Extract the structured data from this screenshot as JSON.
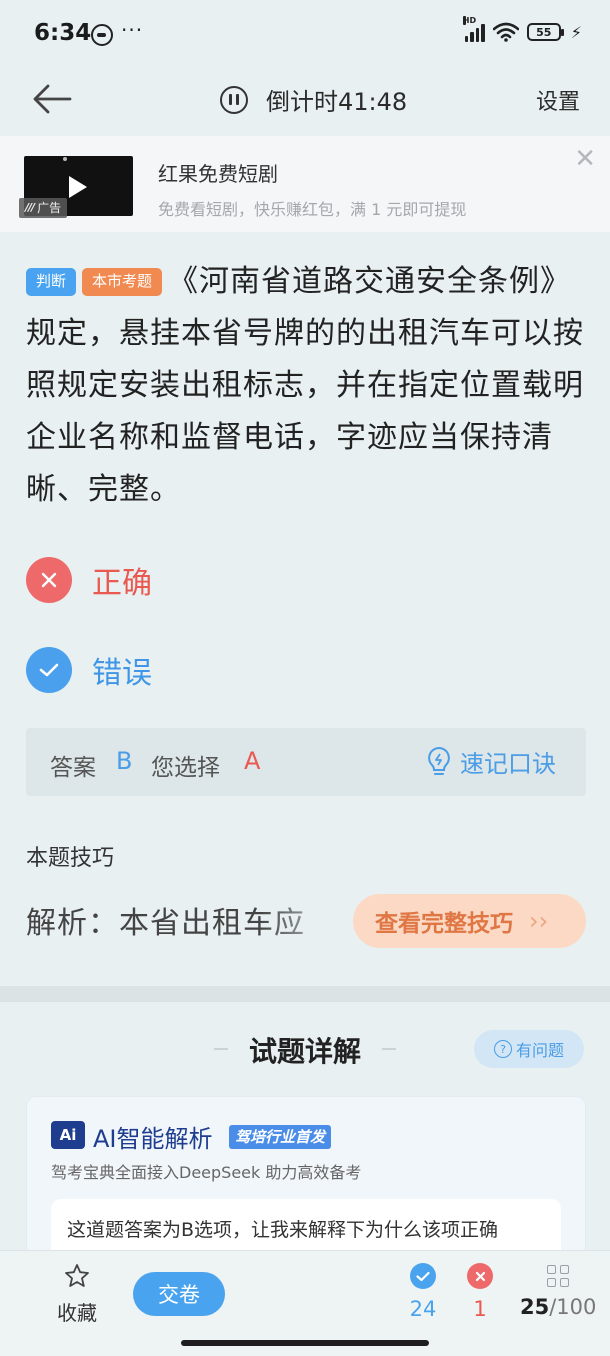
{
  "status_bar": {
    "time": "6:34",
    "dots": "···",
    "battery": "55"
  },
  "header": {
    "timer_label": "倒计时41:48",
    "settings_label": "设置"
  },
  "ad": {
    "title": "红果免费短剧",
    "subtitle": "免费看短剧，快乐赚红包，满 1 元即可提现",
    "badge": "广告"
  },
  "question": {
    "tags": [
      "判断",
      "本市考题"
    ],
    "text": "《河南省道路交通安全条例》规定，悬挂本省号牌的的出租汽车可以按照规定安装出租标志，并在指定位置载明企业名称和监督电话，字迹应当保持清晰、完整。"
  },
  "options": [
    {
      "label": "正确",
      "state": "wrong"
    },
    {
      "label": "错误",
      "state": "correct"
    }
  ],
  "answer": {
    "answer_label": "答案",
    "answer_value": "B",
    "selected_label": "您选择",
    "selected_value": "A",
    "mnemonic_label": "速记口诀"
  },
  "tips": {
    "title": "本题技巧",
    "preview": "解析：本省出租车应",
    "button_label": "查看完整技巧"
  },
  "details": {
    "title": "试题详解",
    "problem_label": "有问题",
    "ai": {
      "logo": "Ai",
      "title": "AI智能解析",
      "badge": "驾培行业首发",
      "subtitle": "驾考宝典全面接入DeepSeek 助力高效备考",
      "bubble_text": "这道题答案为B选项，让我来解释下为什么该项正确"
    }
  },
  "bottom_bar": {
    "favorite_label": "收藏",
    "submit_label": "交卷",
    "correct_count": "24",
    "wrong_count": "1",
    "progress_current": "25",
    "progress_total": "/100"
  },
  "colors": {
    "accent_blue": "#4aa3ee",
    "wrong_red": "#ee6a6a",
    "tip_orange": "#e07644"
  }
}
